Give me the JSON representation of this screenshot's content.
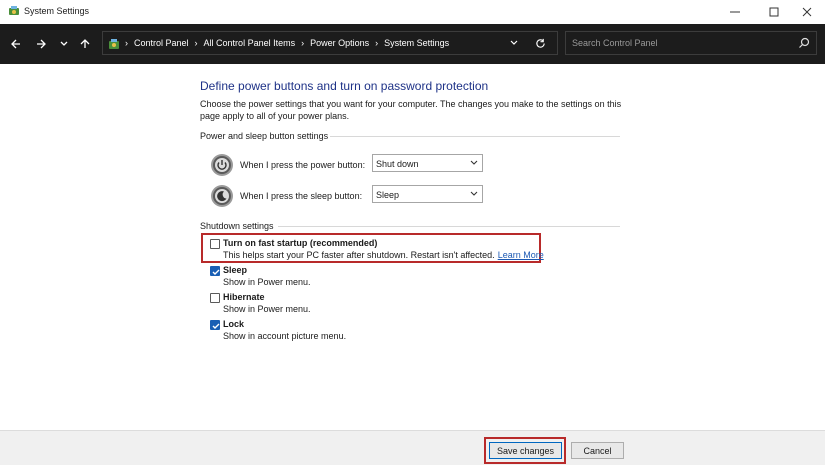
{
  "window": {
    "title": "System Settings",
    "controls": [
      "minimize",
      "maximize",
      "close"
    ]
  },
  "navigation": {
    "breadcrumbs": [
      "Control Panel",
      "All Control Panel Items",
      "Power Options",
      "System Settings"
    ],
    "search_placeholder": "Search Control Panel"
  },
  "page": {
    "heading": "Define power buttons and turn on password protection",
    "description": "Choose the power settings that you want for your computer. The changes you make to the settings on this page apply to all of your power plans.",
    "power_section": {
      "label": "Power and sleep button settings",
      "rows": [
        {
          "label": "When I press the power button:",
          "value": "Shut down",
          "icon": "power-button-icon"
        },
        {
          "label": "When I press the sleep button:",
          "value": "Sleep",
          "icon": "sleep-button-icon"
        }
      ]
    },
    "shutdown_section": {
      "label": "Shutdown settings",
      "items": [
        {
          "title": "Turn on fast startup (recommended)",
          "description": "This helps start your PC faster after shutdown. Restart isn't affected.",
          "link": "Learn More",
          "checked": false
        },
        {
          "title": "Sleep",
          "description": "Show in Power menu.",
          "checked": true
        },
        {
          "title": "Hibernate",
          "description": "Show in Power menu.",
          "checked": false
        },
        {
          "title": "Lock",
          "description": "Show in account picture menu.",
          "checked": true
        }
      ]
    }
  },
  "footer": {
    "save_label": "Save changes",
    "cancel_label": "Cancel"
  },
  "colors": {
    "heading": "#1e3287",
    "navbar": "#1c1c1c",
    "highlight": "#b82a2a",
    "checkbox": "#1a5fb4",
    "link": "#1c59b3"
  }
}
